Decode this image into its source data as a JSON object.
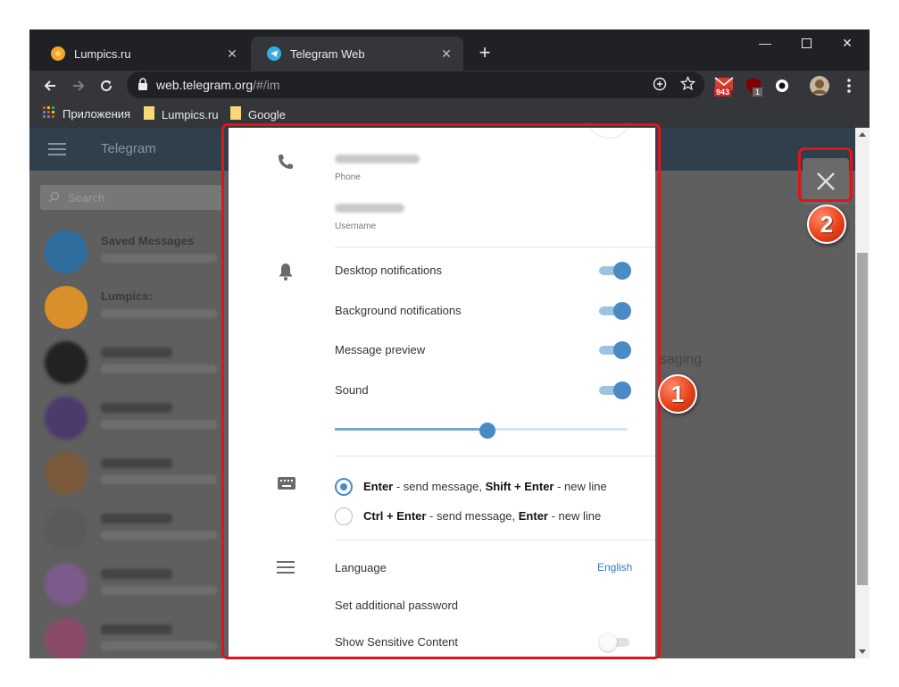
{
  "browser": {
    "tabs": [
      {
        "label": "Lumpics.ru",
        "active": false
      },
      {
        "label": "Telegram Web",
        "active": true
      }
    ],
    "new_tab": "+",
    "url": "web.telegram.org/#/im",
    "url_host": "web.telegram.org",
    "url_path": "/#/im",
    "extensions": [
      {
        "icon": "mail-extension-icon",
        "badge": "943"
      },
      {
        "icon": "ublock-extension-icon",
        "badge": "1"
      }
    ],
    "bookmarks": [
      {
        "label": "Приложения",
        "icon": "apps-grid-icon"
      },
      {
        "label": "Lumpics.ru",
        "icon": "bookmark-folder-icon"
      },
      {
        "label": "Google",
        "icon": "bookmark-folder-icon"
      }
    ]
  },
  "telegram": {
    "header_title": "Telegram",
    "search_placeholder": "Search",
    "chats": [
      {
        "name": "Saved Messages",
        "avatar_color": "#2f6d9e"
      },
      {
        "name": "Lumpics:",
        "avatar_color": "#d9902a"
      },
      {
        "name": "",
        "avatar_color": "#222222"
      },
      {
        "name": "",
        "avatar_color": "#4b3a6b"
      },
      {
        "name": "",
        "avatar_color": "#7a5a3a"
      },
      {
        "name": "",
        "avatar_color": "#5a5a5a"
      },
      {
        "name": "",
        "avatar_color": "#7b5a8c"
      },
      {
        "name": "",
        "avatar_color": "#8a4a6a"
      }
    ],
    "background_text": "saging"
  },
  "settings": {
    "phone_label": "Phone",
    "username_label": "Username",
    "notifications": [
      {
        "label": "Desktop notifications",
        "on": true
      },
      {
        "label": "Background notifications",
        "on": true
      },
      {
        "label": "Message preview",
        "on": true
      },
      {
        "label": "Sound",
        "on": true
      }
    ],
    "sound_volume": 0.52,
    "send_options": [
      {
        "key1": "Enter",
        "text1": " - send message, ",
        "key2": "Shift + Enter",
        "text2": " - new line",
        "selected": true
      },
      {
        "key1": "Ctrl + Enter",
        "text1": " - send message, ",
        "key2": "Enter",
        "text2": " - new line",
        "selected": false
      }
    ],
    "language_label": "Language",
    "language_value": "English",
    "password_label": "Set additional password",
    "sensitive_label": "Show Sensitive Content",
    "sensitive_on": false
  },
  "annotations": {
    "badge1": "1",
    "badge2": "2",
    "accent_color": "#e2141b"
  }
}
